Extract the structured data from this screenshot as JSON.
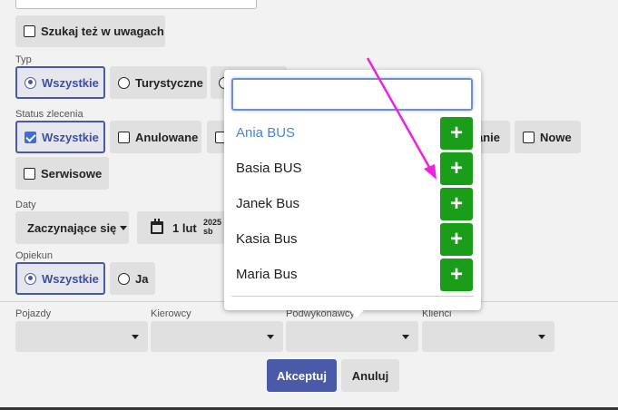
{
  "search_in_notes": {
    "label": "Szukaj też w uwagach"
  },
  "type_group": {
    "label": "Typ",
    "options": [
      {
        "label": "Wszystkie"
      },
      {
        "label": "Turystyczne"
      }
    ]
  },
  "status_group": {
    "label": "Status zlecenia",
    "options": [
      {
        "label": "Wszystkie"
      },
      {
        "label": "Anulowane"
      },
      {
        "label": "anie"
      },
      {
        "label": "Nowe"
      },
      {
        "label": "Serwisowe"
      }
    ]
  },
  "dates": {
    "label": "Daty",
    "mode": "Zaczynające się",
    "date_day": "1 lut",
    "date_year": "2025",
    "date_weekday": "sb"
  },
  "caretaker_group": {
    "label": "Opiekun",
    "options": [
      {
        "label": "Wszystkie"
      },
      {
        "label": "Ja"
      }
    ]
  },
  "filters": {
    "vehicles": {
      "label": "Pojazdy"
    },
    "drivers": {
      "label": "Kierowcy"
    },
    "subcontractors": {
      "label": "Podwykonawcy"
    },
    "clients": {
      "label": "Klienci"
    }
  },
  "actions": {
    "accept": "Akceptuj",
    "cancel": "Anuluj"
  },
  "popup": {
    "search_value": "",
    "items": [
      {
        "name": "Ania BUS"
      },
      {
        "name": "Basia BUS"
      },
      {
        "name": "Janek Bus"
      },
      {
        "name": "Kasia Bus"
      },
      {
        "name": "Maria Bus"
      }
    ],
    "add_glyph": "+"
  },
  "colors": {
    "accent": "#4a5aa8",
    "add_green": "#1a9e1a",
    "annotation_arrow": "#ee22dd",
    "highlight_text": "#4a86d8"
  }
}
